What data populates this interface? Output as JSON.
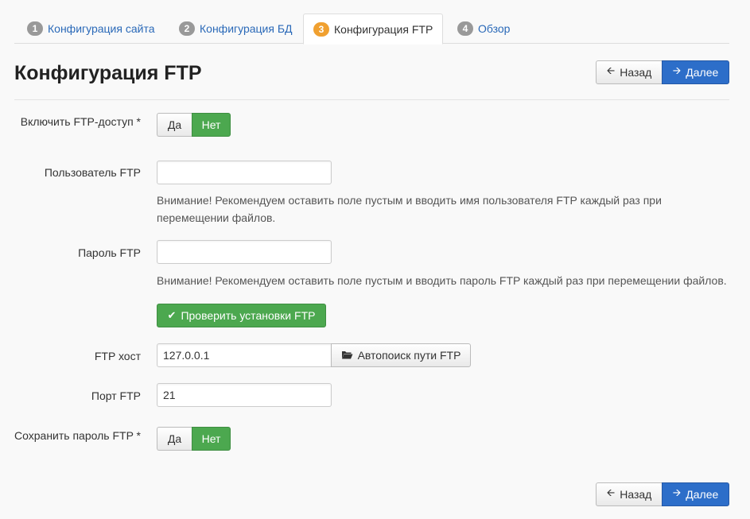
{
  "tabs": [
    {
      "num": "1",
      "label": "Конфигурация сайта"
    },
    {
      "num": "2",
      "label": "Конфигурация БД"
    },
    {
      "num": "3",
      "label": "Конфигурация FTP"
    },
    {
      "num": "4",
      "label": "Обзор"
    }
  ],
  "page": {
    "title": "Конфигурация FTP"
  },
  "nav": {
    "back_label": "Назад",
    "next_label": "Далее",
    "back_icon": "arrow-left-icon",
    "next_icon": "arrow-right-icon"
  },
  "ftp_enable": {
    "label": "Включить FTP-доступ *",
    "yes": "Да",
    "no": "Нет",
    "selected": "Нет"
  },
  "ftp_user": {
    "label": "Пользователь FTP",
    "value": "",
    "help": "Внимание! Рекомендуем оставить поле пустым и вводить имя пользователя FTP каждый раз при перемещении файлов."
  },
  "ftp_pass": {
    "label": "Пароль FTP",
    "value": "",
    "help": "Внимание! Рекомендуем оставить поле пустым и вводить пароль FTP каждый раз при перемещении файлов."
  },
  "verify_button": {
    "label": "Проверить установки FTP",
    "icon": "check-icon"
  },
  "ftp_host": {
    "label": "FTP хост",
    "value": "127.0.0.1",
    "autosearch_label": "Автопоиск пути FTP",
    "autosearch_icon": "folder-open-icon"
  },
  "ftp_port": {
    "label": "Порт FTP",
    "value": "21"
  },
  "save_pass": {
    "label": "Сохранить пароль FTP *",
    "yes": "Да",
    "no": "Нет",
    "selected": "Нет"
  },
  "colors": {
    "primary": "#2d6ec9",
    "success": "#4ca84f",
    "active_badge": "#f0a030",
    "link": "#2a69b8"
  }
}
